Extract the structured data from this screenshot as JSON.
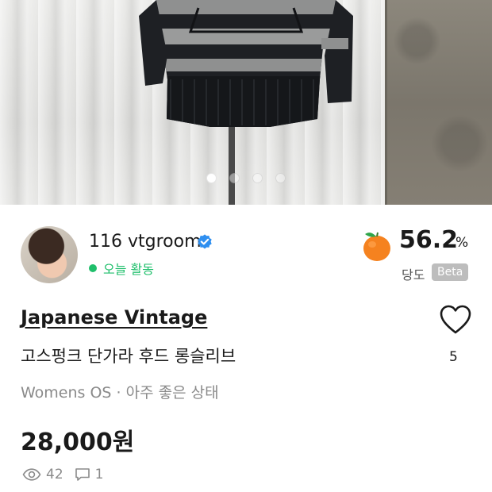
{
  "photo": {
    "slide_count": 4,
    "active_slide": 1
  },
  "seller": {
    "name": "116 vtgroom",
    "verified": true,
    "activity": "오늘 활동"
  },
  "sweetness": {
    "value": "56.2",
    "unit": "%",
    "label": "당도",
    "badge": "Beta",
    "icon": "peach-icon"
  },
  "product": {
    "brand": "Japanese Vintage",
    "title": "고스펑크 단가라 후드 롱슬리브",
    "meta": "Womens OS · 아주 좋은 상태",
    "price": "28,000원",
    "likes": "5",
    "views": "42",
    "comments": "1"
  },
  "colors": {
    "active_green": "#1fbf6b",
    "verified_blue": "#2f8ff0",
    "fruit_orange": "#f5821f",
    "muted_gray": "#8a8a8a"
  }
}
